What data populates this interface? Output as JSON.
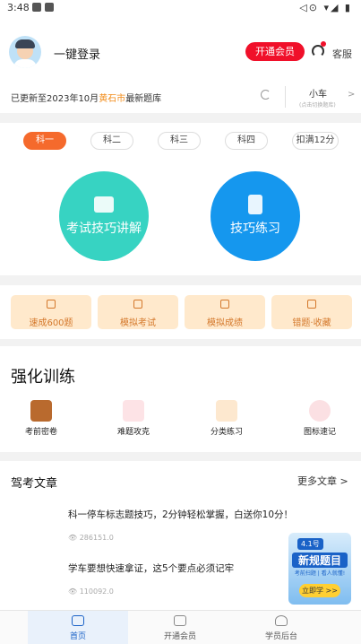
{
  "status_bar": {
    "time": "3:48",
    "right": "◁⊙ ▾◢ ▮"
  },
  "header": {
    "login_label": "一键登录",
    "vip_button": "开通会员",
    "service_label": "客服"
  },
  "update_bar": {
    "prefix": "已更新至2023年10月",
    "city": "黄石市",
    "suffix": "最新题库",
    "car_type": "小车",
    "car_sub": "(点击切换题库)"
  },
  "subject_tabs": [
    "科一",
    "科二",
    "科三",
    "科四",
    "扣满12分"
  ],
  "big_buttons": {
    "left": "考试技巧讲解",
    "right": "技巧练习"
  },
  "quick_actions": [
    "速成600题",
    "模拟考试",
    "模拟成绩",
    "错题·收藏"
  ],
  "training": {
    "title": "强化训练",
    "items": [
      "考前密卷",
      "难题攻克",
      "分类练习",
      "图标速记"
    ]
  },
  "articles": {
    "title": "驾考文章",
    "more": "更多文章 >",
    "items": [
      {
        "title": "科一停车标志题技巧，2分钟轻松掌握，白送你10分！",
        "views": "286151.0"
      },
      {
        "title": "学车要想快速拿证，这5个要点必须记牢",
        "views": "110092.0"
      }
    ]
  },
  "promo": {
    "tag": "4.1号",
    "headline": "新规题目",
    "sub": "考前扫题 | 看人就懂!",
    "button": "立即学 >>"
  },
  "nav": [
    "首页",
    "开通会员",
    "学员后台"
  ],
  "colors": {
    "accent_orange": "#f56a2c",
    "teal": "#37d3c2",
    "blue": "#1597ee",
    "vip_red": "#f0102a"
  }
}
